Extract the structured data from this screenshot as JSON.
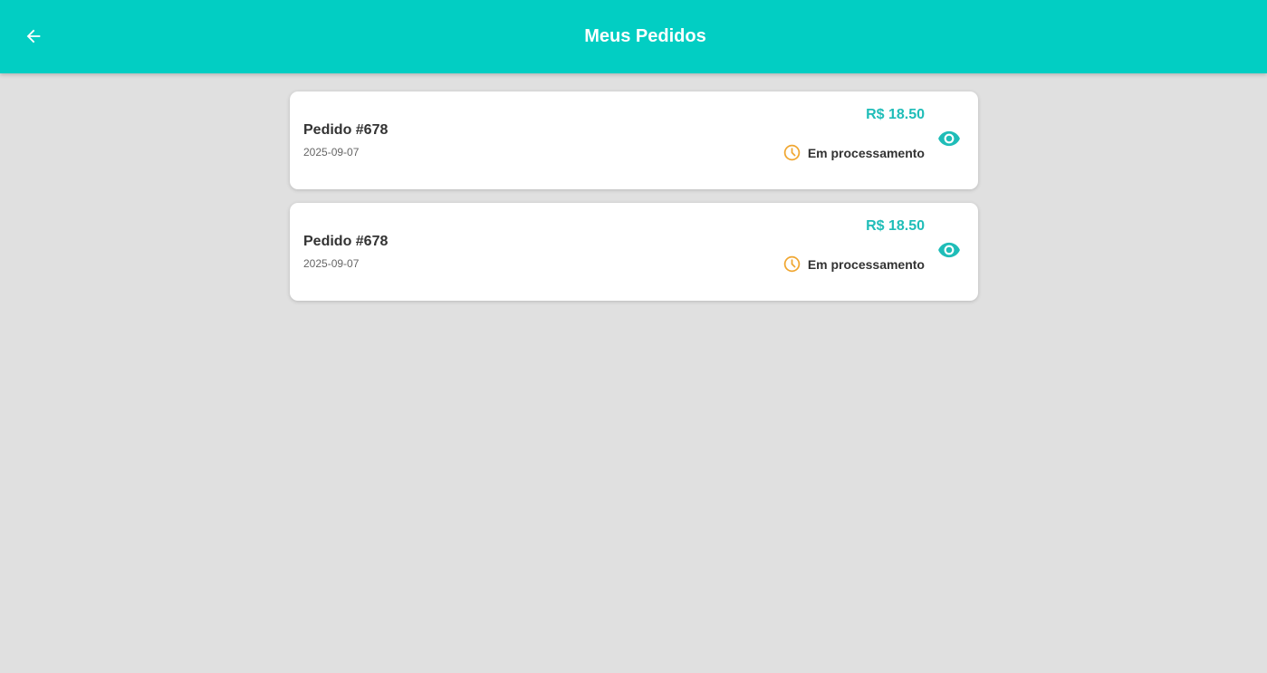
{
  "header": {
    "title": "Meus Pedidos",
    "back_icon": "arrow-left-icon",
    "background_color": "#02cec3"
  },
  "orders": [
    {
      "title": "Pedido #678",
      "date": "2025-09-07",
      "price": "R$ 18.50",
      "status": "Em processamento",
      "status_icon": "clock-icon",
      "action_icon": "eye-icon"
    },
    {
      "title": "Pedido #678",
      "date": "2025-09-07",
      "price": "R$ 18.50",
      "status": "Em processamento",
      "status_icon": "clock-icon",
      "action_icon": "eye-icon"
    }
  ],
  "colors": {
    "accent": "#1fbdb8",
    "status_pending": "#f0a630",
    "background": "#e0e0e0"
  }
}
